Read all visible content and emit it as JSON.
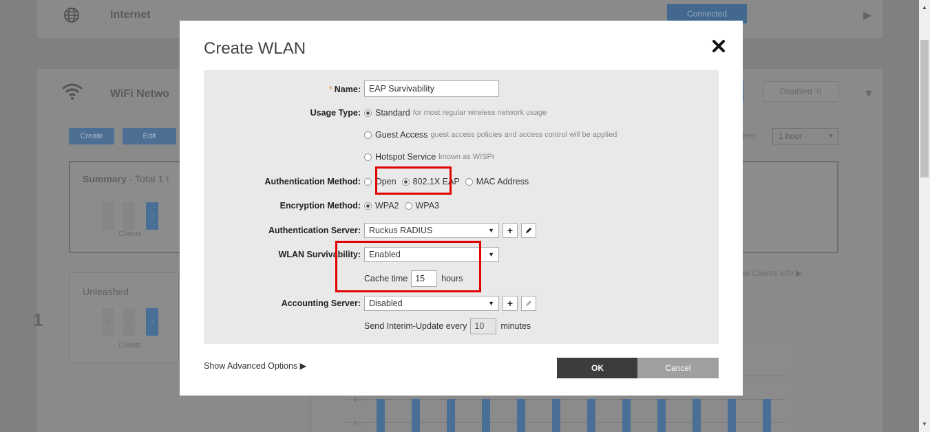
{
  "background": {
    "internet": {
      "title": "Internet",
      "status": "Connected"
    },
    "wifi": {
      "title": "WiFi Netwo",
      "create_label": "Create",
      "edit_label": "Edit",
      "disabled_label": "Disabled",
      "disabled_count": "0",
      "duration_label": "ation:",
      "duration_value": "1 hour",
      "summary_label": "Summary",
      "summary_suffix": "- Total 1 \\",
      "unleashed_label": "Unleashed",
      "row_number": "1",
      "clients_label": "Clients",
      "counter_zero": "0",
      "counter_four": "4",
      "show_clients_label": "ow Clients Info",
      "tick_4": "4",
      "tick_3": "3"
    }
  },
  "modal": {
    "title": "Create WLAN",
    "name": {
      "label": "Name:",
      "required_mark": "*",
      "value": "EAP Survivability"
    },
    "usage_type": {
      "label": "Usage Type:",
      "options": [
        {
          "label": "Standard",
          "hint": "for most regular wireless network usage",
          "selected": true
        },
        {
          "label": "Guest Access",
          "hint": "guest access policies and access control will be applied",
          "selected": false
        },
        {
          "label": "Hotspot Service",
          "hint": "known as WISPr",
          "selected": false
        }
      ]
    },
    "auth_method": {
      "label": "Authentication Method:",
      "options": [
        {
          "label": "Open",
          "selected": false
        },
        {
          "label": "802.1X EAP",
          "selected": true
        },
        {
          "label": "MAC Address",
          "selected": false
        }
      ]
    },
    "encryption": {
      "label": "Encryption Method:",
      "options": [
        {
          "label": "WPA2",
          "selected": true
        },
        {
          "label": "WPA3",
          "selected": false
        }
      ]
    },
    "auth_server": {
      "label": "Authentication Server:",
      "value": "Ruckus RADIUS",
      "add_icon": "plus-icon",
      "edit_icon": "pencil-icon"
    },
    "survivability": {
      "label": "WLAN Survivability:",
      "value": "Enabled",
      "cache_label": "Cache time",
      "cache_value": "15",
      "cache_unit": "hours"
    },
    "accounting_server": {
      "label": "Accounting Server:",
      "value": "Disabled",
      "interim_prefix": "Send Interim-Update every",
      "interim_value": "10",
      "interim_unit": "minutes"
    },
    "advanced_label": "Show Advanced Options ▶",
    "ok_label": "OK",
    "cancel_label": "Cancel"
  },
  "colors": {
    "highlight": "#e00000",
    "required": "#e38a28",
    "ok_button": "#3c3c3c",
    "cancel_button": "#a0a0a0"
  }
}
